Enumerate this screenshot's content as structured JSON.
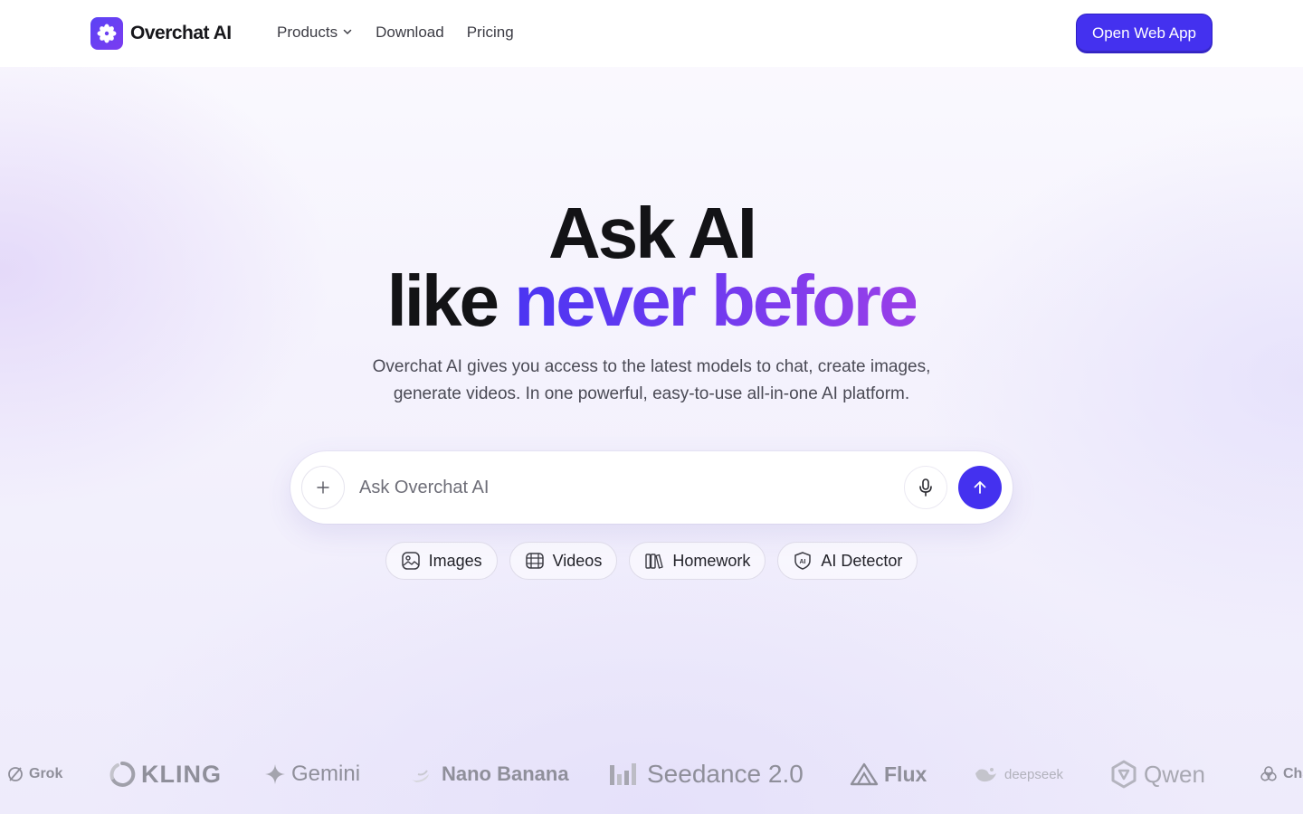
{
  "header": {
    "logo_text": "Overchat AI",
    "nav": [
      {
        "label": "Products",
        "has_dropdown": true
      },
      {
        "label": "Download",
        "has_dropdown": false
      },
      {
        "label": "Pricing",
        "has_dropdown": false
      }
    ],
    "cta_label": "Open Web App"
  },
  "hero": {
    "title_line1": "Ask AI",
    "title_line2_plain": "like",
    "title_line2_accent": "never before",
    "subtitle_line1": "Overchat AI gives you access to the latest models to chat, create images,",
    "subtitle_line2": "generate videos. In one powerful, easy-to-use all-in-one AI platform."
  },
  "search": {
    "placeholder": "Ask Overchat AI",
    "value": ""
  },
  "chips": [
    {
      "label": "Images",
      "icon": "image-icon"
    },
    {
      "label": "Videos",
      "icon": "video-icon"
    },
    {
      "label": "Homework",
      "icon": "books-icon"
    },
    {
      "label": "AI Detector",
      "icon": "shield-ai-icon"
    }
  ],
  "models": [
    {
      "name": "Grok",
      "icon": "grok-icon"
    },
    {
      "name": "KLING",
      "icon": "kling-icon"
    },
    {
      "name": "Gemini",
      "icon": "gemini-icon"
    },
    {
      "name": "Nano Banana",
      "icon": "banana-icon"
    },
    {
      "name": "Seedance 2.0",
      "icon": "seedance-icon"
    },
    {
      "name": "Flux",
      "icon": "flux-icon"
    },
    {
      "name": "deepseek",
      "icon": "deepseek-icon"
    },
    {
      "name": "Qwen",
      "icon": "qwen-icon"
    },
    {
      "name": "Cha",
      "icon": "chatgpt-icon"
    }
  ],
  "colors": {
    "accent": "#4431ef",
    "gradient_start": "#4b35f2",
    "gradient_end": "#9a3fe8",
    "logo_gray": "#8f8f9a"
  }
}
